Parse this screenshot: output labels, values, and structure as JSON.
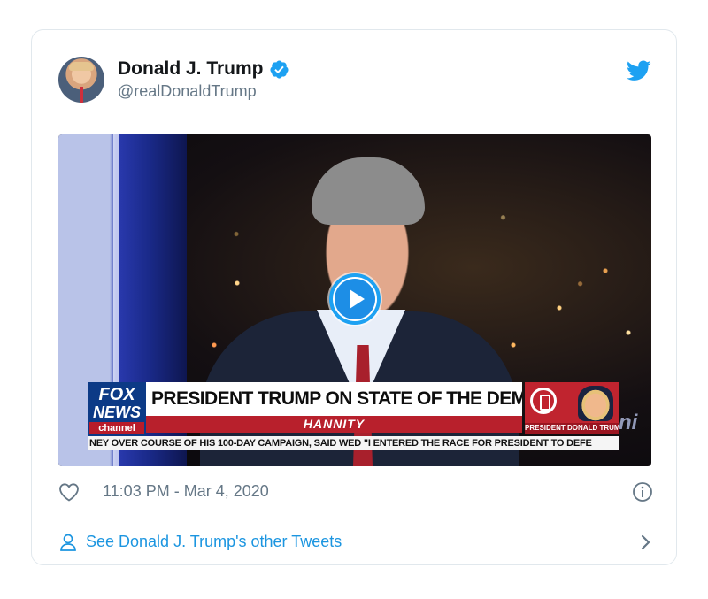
{
  "tweet": {
    "author": {
      "display_name": "Donald J. Trump",
      "handle": "@realDonaldTrump",
      "verified": true
    },
    "media": {
      "type": "video",
      "chyron": {
        "network_logo_line1": "FOX",
        "network_logo_line2": "NEWS",
        "network_logo_line3": "channel",
        "headline": "PRESIDENT TRUMP ON STATE OF THE DEM PRIMARY",
        "show_name": "HANNITY",
        "thumb_caption": "PRESIDENT DONALD TRUMP",
        "ticker": "NEY OVER COURSE OF HIS 100-DAY CAMPAIGN, SAID WED \"I ENTERED THE RACE FOR PRESIDENT TO DEFE",
        "ticker_fragment": "ni"
      }
    },
    "timestamp": "11:03 PM - Mar 4, 2020",
    "footer_link": "See Donald J. Trump's other Tweets"
  },
  "icons": {
    "verified": "verified-badge-icon",
    "brand": "twitter-bird-icon",
    "like": "heart-icon",
    "info": "info-icon",
    "person": "person-icon",
    "chevron": "chevron-right-icon",
    "play": "play-icon"
  },
  "colors": {
    "accent": "#1da1f2",
    "link": "#1b95e0",
    "muted_text": "#657786",
    "primary_text": "#14171a",
    "border": "#e1e8ed",
    "fox_blue": "#0c3a86",
    "fox_red": "#b8202c"
  }
}
